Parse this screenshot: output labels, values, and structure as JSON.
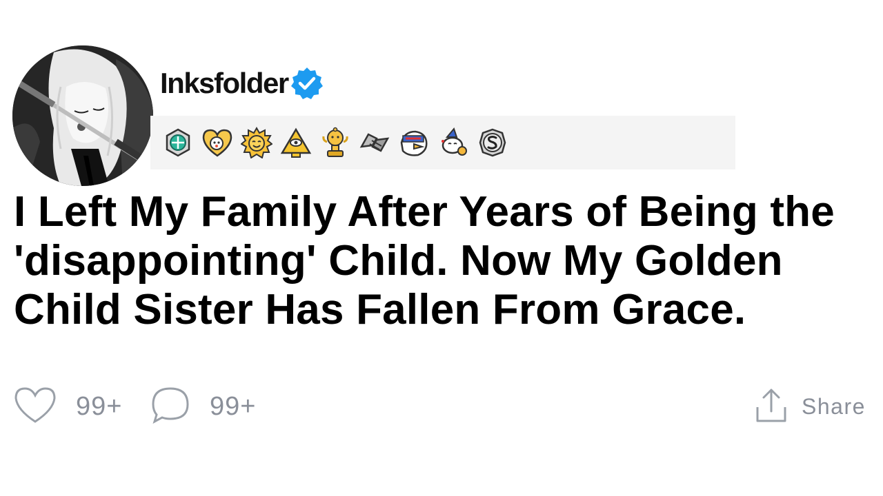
{
  "post": {
    "author": {
      "username": "Inksfolder",
      "verified": true,
      "avatar_icon": "avatar-anime-swordswoman"
    },
    "awards": [
      "silver-gem-award-icon",
      "wholesome-heart-award-icon",
      "smiling-sun-award-icon",
      "illuminati-pyramid-award-icon",
      "gold-trophy-snoo-award-icon",
      "handshake-award-icon",
      "patriot-eagle-award-icon",
      "party-snoo-award-icon",
      "silver-s-coin-award-icon"
    ],
    "title": "I Left My Family After Years of Being the 'disappointing' Child. Now My Golden Child Sister Has Fallen From Grace.",
    "actions": {
      "likes": "99+",
      "comments": "99+",
      "share_label": "Share"
    }
  },
  "colors": {
    "verified_badge": "#1d9bf0",
    "action_gray": "#8a8f99",
    "awards_bg": "#f4f4f4"
  }
}
